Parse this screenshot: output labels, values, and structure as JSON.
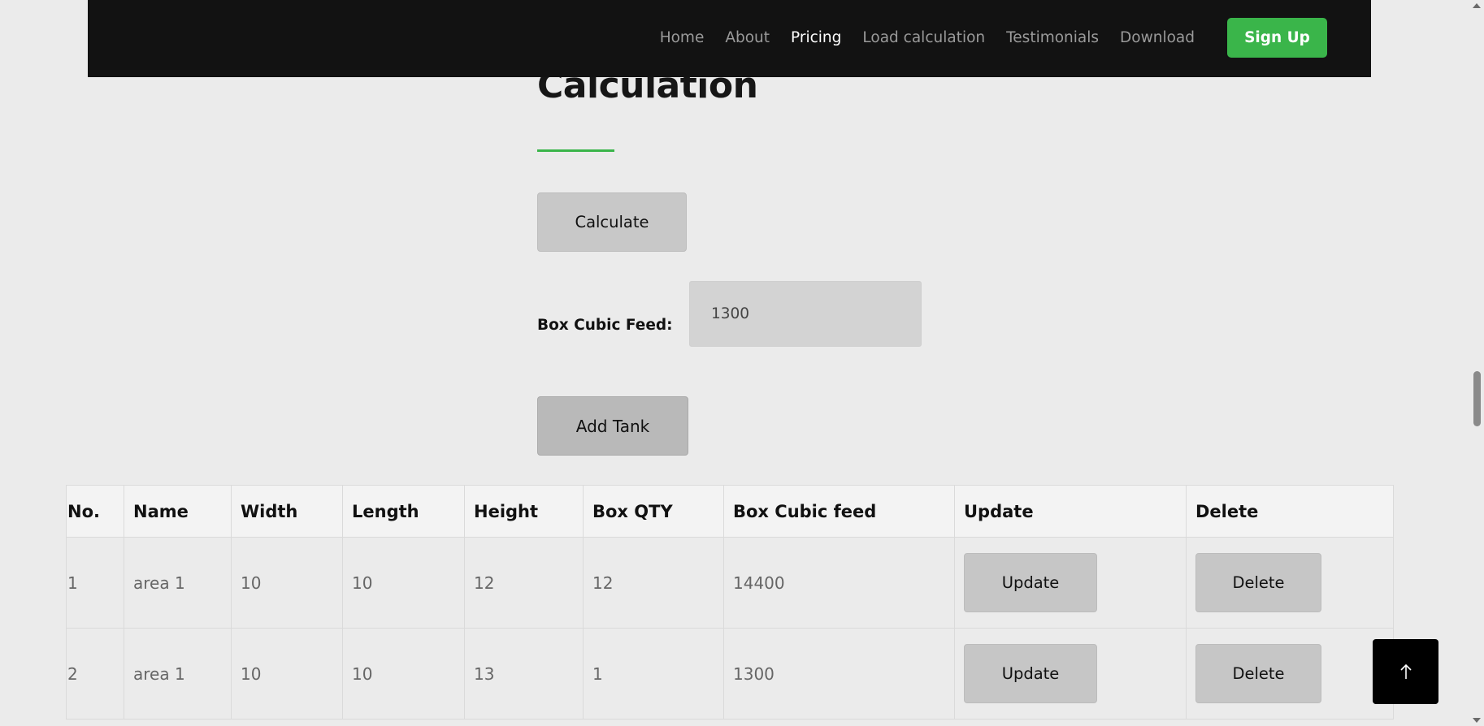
{
  "nav": {
    "items": [
      {
        "label": "Home",
        "active": false
      },
      {
        "label": "About",
        "active": false
      },
      {
        "label": "Pricing",
        "active": true
      },
      {
        "label": "Load calculation",
        "active": false
      },
      {
        "label": "Testimonials",
        "active": false
      },
      {
        "label": "Download",
        "active": false
      }
    ],
    "signup_label": "Sign Up"
  },
  "main": {
    "title": "Calculation",
    "calculate_label": "Calculate",
    "box_cubic_label": "Box Cubic Feed:",
    "box_cubic_value": "1300",
    "add_tank_label": "Add Tank"
  },
  "table": {
    "headers": [
      "No.",
      "Name",
      "Width",
      "Length",
      "Height",
      "Box QTY",
      "Box Cubic feed",
      "Update",
      "Delete"
    ],
    "rows": [
      {
        "no": "1",
        "name": "area 1",
        "width": "10",
        "length": "10",
        "height": "12",
        "box_qty": "12",
        "box_cubic_feed": "14400",
        "update_label": "Update",
        "delete_label": "Delete"
      },
      {
        "no": "2",
        "name": "area 1",
        "width": "10",
        "length": "10",
        "height": "13",
        "box_qty": "1",
        "box_cubic_feed": "1300",
        "update_label": "Update",
        "delete_label": "Delete"
      }
    ]
  },
  "colors": {
    "accent": "#3ab54a",
    "navbar_bg": "#121212",
    "page_bg": "#ebebeb"
  },
  "icons": {
    "scroll_top": "arrow-up-icon"
  }
}
